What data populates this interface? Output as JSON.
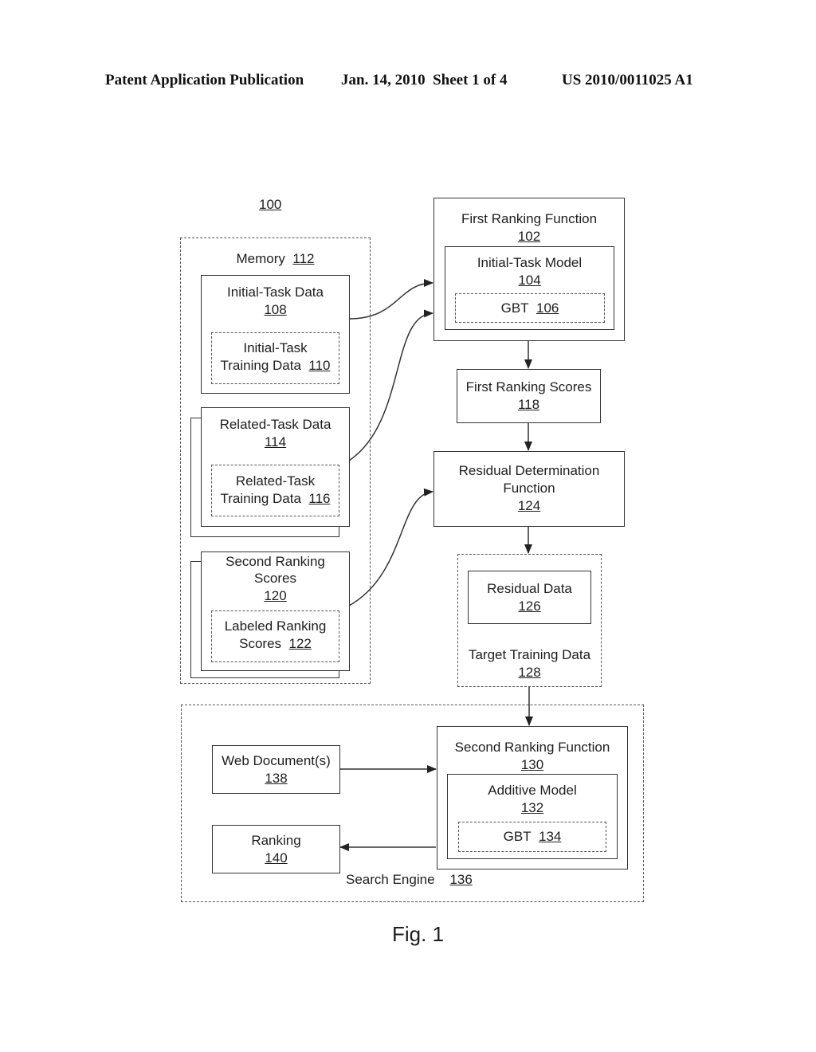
{
  "header": {
    "publication": "Patent Application Publication",
    "date_sheet": "Jan. 14, 2010  Sheet 1 of 4",
    "number": "US 2010/0011025 A1"
  },
  "figure": {
    "ref": "100",
    "caption": "Fig. 1"
  },
  "memory": {
    "label": "Memory",
    "ref": "112"
  },
  "initial_task_data": {
    "label": "Initial-Task Data",
    "ref": "108",
    "training": {
      "label_line1": "Initial-Task",
      "label_line2": "Training Data",
      "ref": "110"
    }
  },
  "related_task_data": {
    "label": "Related-Task Data",
    "ref": "114",
    "training": {
      "label_line1": "Related-Task",
      "label_line2": "Training Data",
      "ref": "116"
    }
  },
  "second_ranking_scores": {
    "label_line1": "Second Ranking",
    "label_line2": "Scores",
    "ref": "120",
    "labeled": {
      "label_line1": "Labeled Ranking",
      "label_line2": "Scores",
      "ref": "122"
    }
  },
  "first_ranking_function": {
    "label": "First Ranking Function",
    "ref": "102",
    "model": {
      "label": "Initial-Task Model",
      "ref": "104",
      "gbt": {
        "label": "GBT",
        "ref": "106"
      }
    }
  },
  "first_ranking_scores": {
    "label": "First Ranking Scores",
    "ref": "118"
  },
  "residual_function": {
    "label_line1": "Residual Determination",
    "label_line2": "Function",
    "ref": "124"
  },
  "target_training_data": {
    "label": "Target Training Data",
    "ref": "128",
    "residual_data": {
      "label": "Residual Data",
      "ref": "126"
    }
  },
  "search_engine": {
    "label": "Search Engine",
    "ref": "136",
    "web_documents": {
      "label": "Web Document(s)",
      "ref": "138"
    },
    "ranking": {
      "label": "Ranking",
      "ref": "140"
    },
    "second_ranking_function": {
      "label": "Second Ranking Function",
      "ref": "130",
      "model": {
        "label": "Additive Model",
        "ref": "132",
        "gbt": {
          "label": "GBT",
          "ref": "134"
        }
      }
    }
  }
}
